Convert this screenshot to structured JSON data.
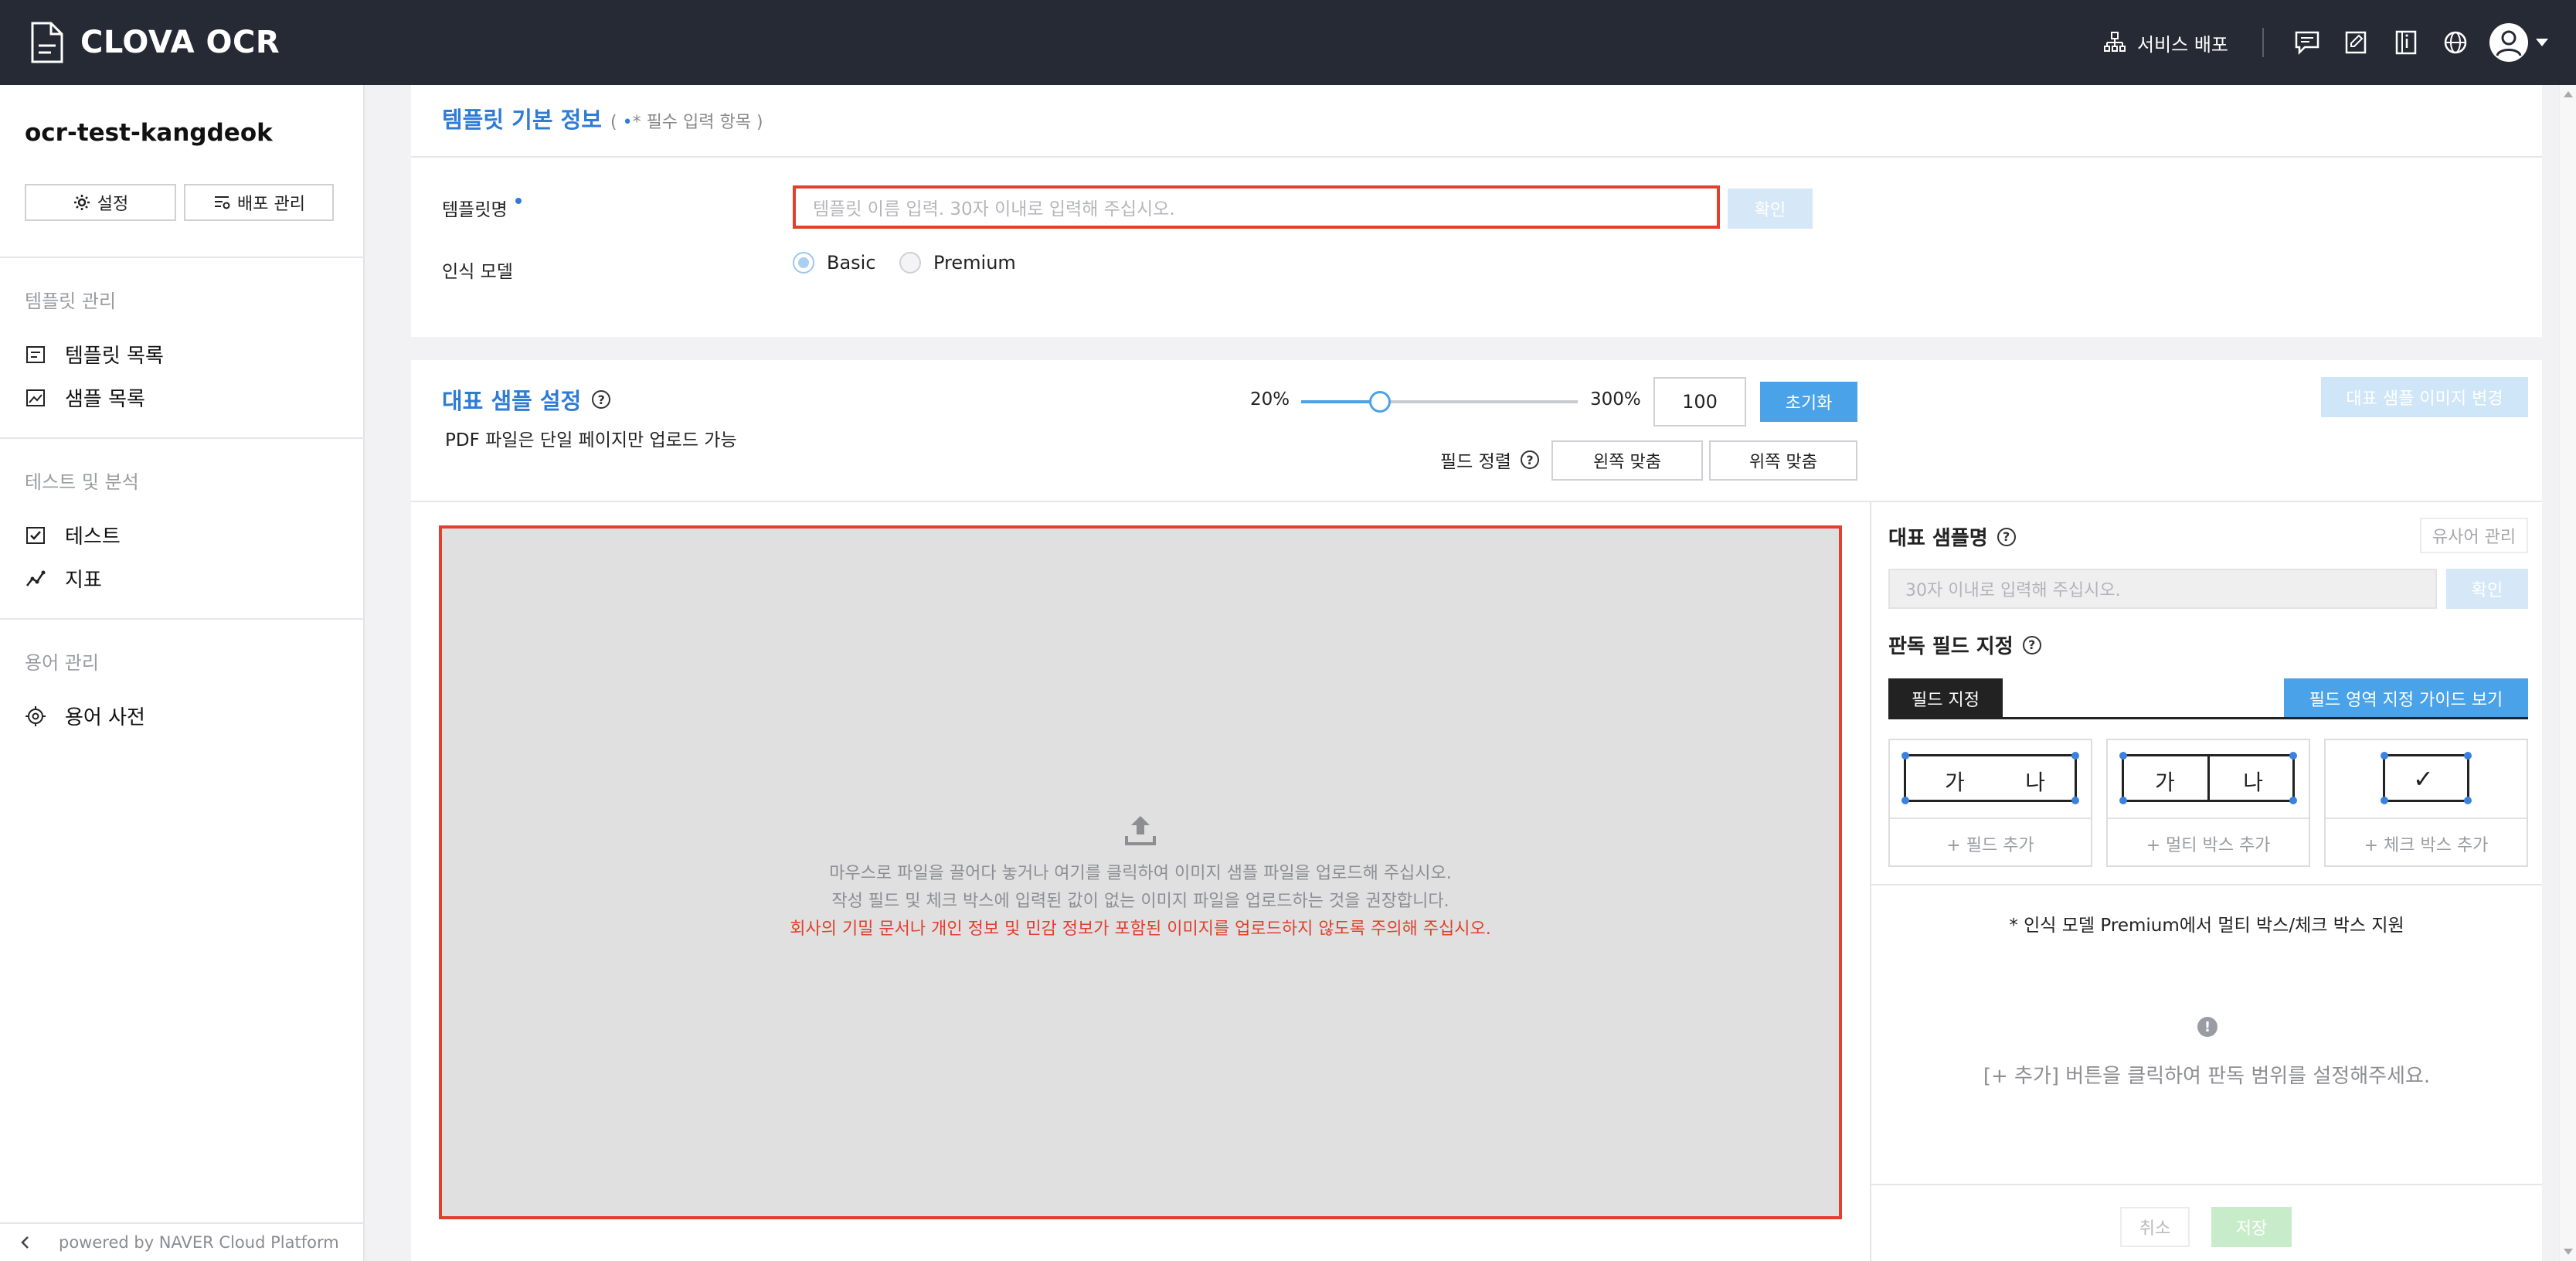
{
  "header": {
    "logo_text": "CLOVA OCR",
    "deploy_label": "서비스 배포",
    "icons": [
      "feedback-icon",
      "notice-icon",
      "guide-icon",
      "language-icon",
      "profile-icon"
    ]
  },
  "sidebar": {
    "project": "ocr-test-kangdeok",
    "settings_label": "설정",
    "deploy_mgmt_label": "배포 관리",
    "sections": [
      {
        "title": "템플릿 관리",
        "items": [
          {
            "label": "템플릿 목록",
            "icon": "list-icon"
          },
          {
            "label": "샘플 목록",
            "icon": "image-icon"
          }
        ]
      },
      {
        "title": "테스트 및 분석",
        "items": [
          {
            "label": "테스트",
            "icon": "check-doc-icon"
          },
          {
            "label": "지표",
            "icon": "chart-icon"
          }
        ]
      },
      {
        "title": "용어 관리",
        "items": [
          {
            "label": "용어 사전",
            "icon": "target-icon"
          }
        ]
      }
    ],
    "footer": "powered by NAVER Cloud Platform"
  },
  "template_info": {
    "title": "템플릿 기본 정보",
    "required_note_open": "(",
    "required_note_dot": "•",
    "required_note_text": "* 필수 입력 항목 )",
    "name_label": "템플릿명",
    "name_placeholder": "템플릿 이름 입력. 30자 이내로 입력해 주십시오.",
    "confirm_label": "확인",
    "model_label": "인식 모델",
    "model_options": [
      "Basic",
      "Premium"
    ],
    "model_selected": "Basic"
  },
  "sample_settings": {
    "title": "대표 샘플 설정",
    "pdf_note": "PDF 파일은 단일 페이지만 업로드 가능",
    "zoom_min": "20%",
    "zoom_max": "300%",
    "zoom_value": "100",
    "zoom_level": 100,
    "reset_label": "초기화",
    "change_image_label": "대표 샘플 이미지 변경",
    "align_label": "필드 정렬",
    "align_left_label": "왼쪽 맞춤",
    "align_top_label": "위쪽 맞춤",
    "drop_line1": "마우스로 파일을 끌어다 놓거나 여기를 클릭하여 이미지 샘플 파일을 업로드해 주십시오.",
    "drop_line2": "작성 필드 및 체크 박스에 입력된 값이 없는 이미지 파일을 업로드하는 것을 권장합니다.",
    "drop_warning": "회사의 기밀 문서나 개인 정보 및 민감 정보가 포함된 이미지를 업로드하지 않도록 주의해 주십시오.",
    "colors": {
      "warning": "#e0402c",
      "accent": "#4aa3e8"
    }
  },
  "right_panel": {
    "sample_name_title": "대표 샘플명",
    "synonym_label": "유사어 관리",
    "sample_name_placeholder": "30자 이내로 입력해 주십시오.",
    "confirm_label": "확인",
    "field_title": "판독 필드 지정",
    "tab_label": "필드 지정",
    "guide_label": "필드 영역 지정 가이드 보기",
    "field_types": [
      {
        "add_label": "+ 필드 추가",
        "left": "가",
        "right": "나"
      },
      {
        "add_label": "+ 멀티 박스 추가",
        "left": "가",
        "right": "나"
      },
      {
        "add_label": "+ 체크 박스 추가",
        "mark": "✓"
      }
    ],
    "premium_note": "* 인식 모델 Premium에서 멀티 박스/체크 박스 지원",
    "info_mark": "!",
    "hint": "[+ 추가] 버튼을 클릭하여 판독 범위를 설정해주세요.",
    "cancel_label": "취소",
    "save_label": "저장"
  }
}
